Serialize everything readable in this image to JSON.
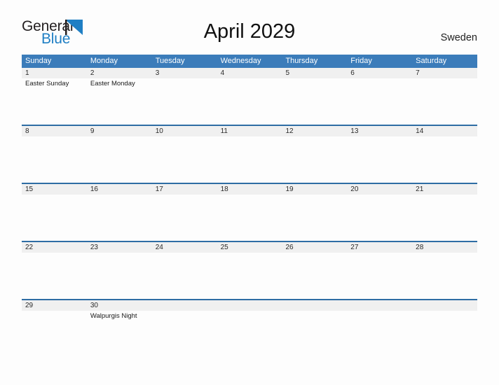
{
  "brand": {
    "name_part1": "General",
    "name_part2": "Blue",
    "flag_icon": "blue-triangle-flag-icon",
    "accent_color": "#1f7fc4"
  },
  "header": {
    "title": "April 2029",
    "country": "Sweden"
  },
  "colors": {
    "header_blue": "#3b7cba",
    "row_divider_blue": "#2e6da4",
    "date_strip_gray": "#f0f0f0",
    "page_background": "#fdfdfd"
  },
  "calendar": {
    "day_headers": [
      "Sunday",
      "Monday",
      "Tuesday",
      "Wednesday",
      "Thursday",
      "Friday",
      "Saturday"
    ],
    "weeks": [
      {
        "days": [
          {
            "date": "1",
            "events": [
              "Easter Sunday"
            ]
          },
          {
            "date": "2",
            "events": [
              "Easter Monday"
            ]
          },
          {
            "date": "3",
            "events": []
          },
          {
            "date": "4",
            "events": []
          },
          {
            "date": "5",
            "events": []
          },
          {
            "date": "6",
            "events": []
          },
          {
            "date": "7",
            "events": []
          }
        ]
      },
      {
        "days": [
          {
            "date": "8",
            "events": []
          },
          {
            "date": "9",
            "events": []
          },
          {
            "date": "10",
            "events": []
          },
          {
            "date": "11",
            "events": []
          },
          {
            "date": "12",
            "events": []
          },
          {
            "date": "13",
            "events": []
          },
          {
            "date": "14",
            "events": []
          }
        ]
      },
      {
        "days": [
          {
            "date": "15",
            "events": []
          },
          {
            "date": "16",
            "events": []
          },
          {
            "date": "17",
            "events": []
          },
          {
            "date": "18",
            "events": []
          },
          {
            "date": "19",
            "events": []
          },
          {
            "date": "20",
            "events": []
          },
          {
            "date": "21",
            "events": []
          }
        ]
      },
      {
        "days": [
          {
            "date": "22",
            "events": []
          },
          {
            "date": "23",
            "events": []
          },
          {
            "date": "24",
            "events": []
          },
          {
            "date": "25",
            "events": []
          },
          {
            "date": "26",
            "events": []
          },
          {
            "date": "27",
            "events": []
          },
          {
            "date": "28",
            "events": []
          }
        ]
      },
      {
        "days": [
          {
            "date": "29",
            "events": []
          },
          {
            "date": "30",
            "events": [
              "Walpurgis Night"
            ]
          },
          {
            "date": "",
            "events": []
          },
          {
            "date": "",
            "events": []
          },
          {
            "date": "",
            "events": []
          },
          {
            "date": "",
            "events": []
          },
          {
            "date": "",
            "events": []
          }
        ]
      }
    ]
  }
}
